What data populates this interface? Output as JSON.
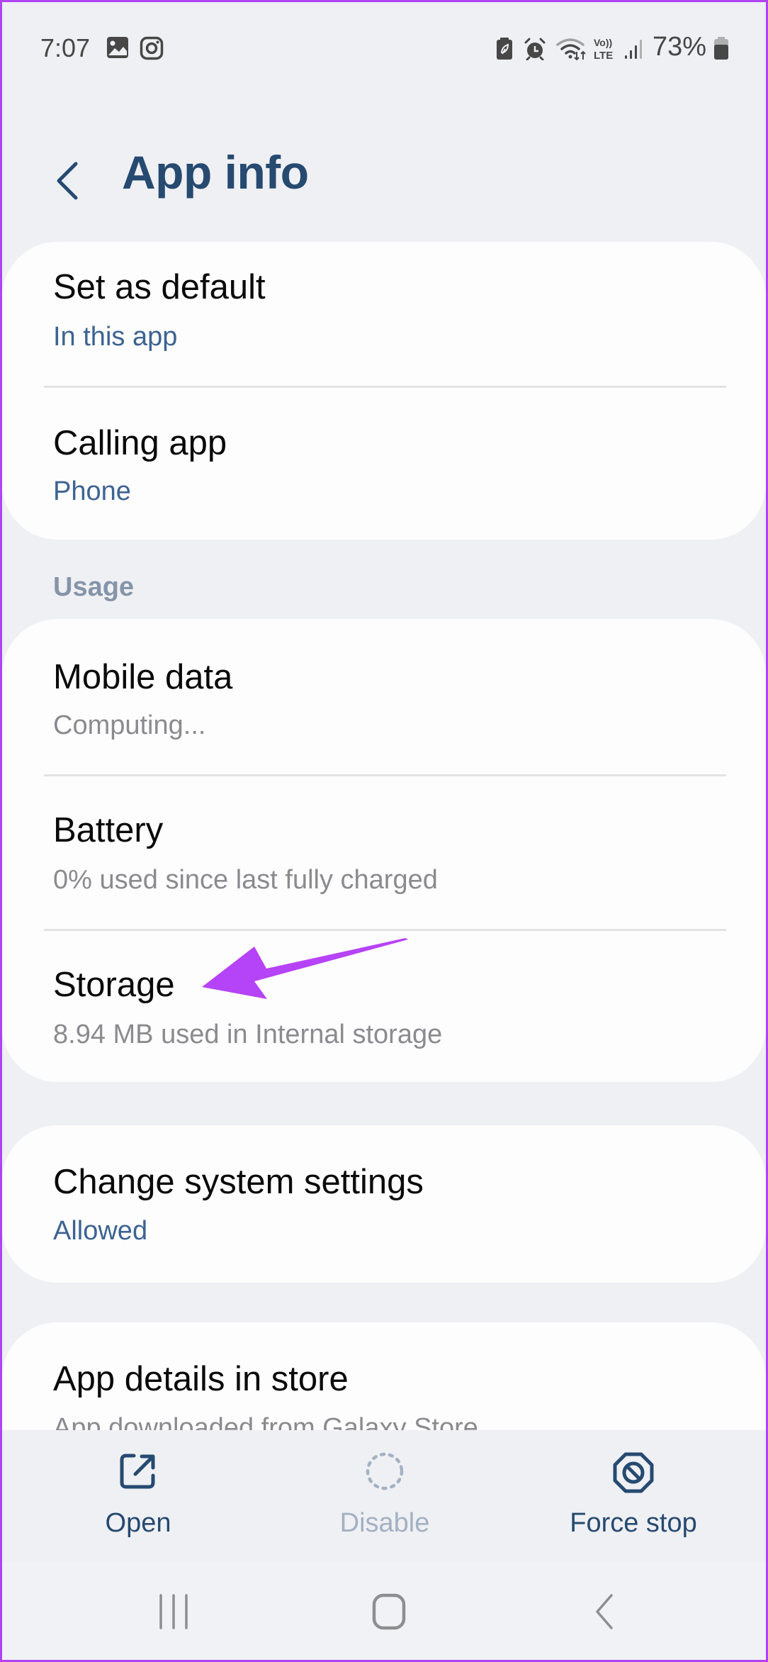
{
  "status_bar": {
    "time": "7:07",
    "left_icons": [
      "gallery-notification-icon",
      "instagram-notification-icon"
    ],
    "right_icons": [
      "power-saving-battery-icon",
      "alarm-icon",
      "wifi-icon",
      "volte-icon",
      "signal-icon"
    ],
    "battery_percent": "73%"
  },
  "header": {
    "back_icon": "chevron-left-icon",
    "title": "App info"
  },
  "cards": [
    {
      "rows": [
        {
          "title": "Set as default",
          "subtitle": "In this app",
          "subtitle_style": "accent"
        },
        {
          "title": "Calling app",
          "subtitle": "Phone",
          "subtitle_style": "accent"
        }
      ]
    },
    {
      "section_label": "Usage",
      "rows": [
        {
          "title": "Mobile data",
          "subtitle": "Computing...",
          "subtitle_style": "muted"
        },
        {
          "title": "Battery",
          "subtitle": "0% used since last fully charged",
          "subtitle_style": "muted"
        },
        {
          "title": "Storage",
          "subtitle": "8.94 MB used in Internal storage",
          "subtitle_style": "muted"
        }
      ]
    },
    {
      "rows": [
        {
          "title": "Change system settings",
          "subtitle": "Allowed",
          "subtitle_style": "accent"
        }
      ]
    },
    {
      "rows": [
        {
          "title": "App details in store",
          "subtitle": "App downloaded from Galaxy Store",
          "subtitle_style": "muted"
        }
      ]
    }
  ],
  "actions": [
    {
      "label": "Open",
      "icon": "open-external-icon",
      "enabled": true
    },
    {
      "label": "Disable",
      "icon": "disable-dotted-circle-icon",
      "enabled": false
    },
    {
      "label": "Force stop",
      "icon": "force-stop-octagon-icon",
      "enabled": true
    }
  ],
  "nav_bar": {
    "buttons": [
      "recent-apps-icon",
      "home-icon",
      "back-icon"
    ]
  },
  "annotation": {
    "type": "arrow",
    "target": "Storage",
    "color": "#b543f7"
  },
  "colors": {
    "title": "#264a70",
    "accent_subtitle": "#3d6391",
    "muted_subtitle": "#8b8b8f",
    "section_label": "#8594a8",
    "background": "#eff0f4",
    "card": "#fdfdfe",
    "frame_border": "#b044f4"
  }
}
